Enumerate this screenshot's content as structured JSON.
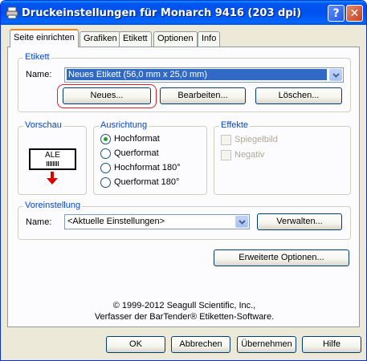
{
  "window": {
    "title": "Druckeinstellungen für Monarch 9416 (203 dpi)",
    "help_icon": "?",
    "close_icon": "✕"
  },
  "tabs": [
    {
      "label": "Seite einrichten",
      "active": true
    },
    {
      "label": "Grafiken",
      "active": false
    },
    {
      "label": "Etikett",
      "active": false
    },
    {
      "label": "Optionen",
      "active": false
    },
    {
      "label": "Info",
      "active": false
    }
  ],
  "etikett": {
    "group_label": "Etikett",
    "name_label": "Name:",
    "name_value": "Neues Etikett (56,0 mm x 25,0 mm)",
    "buttons": {
      "new": "Neues...",
      "edit": "Bearbeiten...",
      "delete": "Löschen..."
    }
  },
  "vorschau": {
    "group_label": "Vorschau",
    "preview_text": "ALE"
  },
  "ausrichtung": {
    "group_label": "Ausrichtung",
    "options": [
      {
        "label": "Hochformat",
        "checked": true
      },
      {
        "label": "Querformat",
        "checked": false
      },
      {
        "label": "Hochformat 180°",
        "checked": false
      },
      {
        "label": "Querformat 180°",
        "checked": false
      }
    ]
  },
  "effekte": {
    "group_label": "Effekte",
    "options": [
      {
        "label": "Spiegelbild",
        "checked": false,
        "enabled": false
      },
      {
        "label": "Negativ",
        "checked": false,
        "enabled": false
      }
    ]
  },
  "voreinstellung": {
    "group_label": "Voreinstellung",
    "name_label": "Name:",
    "name_value": "<Aktuelle Einstellungen>",
    "manage_button": "Verwalten..."
  },
  "advanced_button": "Erweiterte Optionen...",
  "copyright": {
    "line1": "© 1999-2012 Seagull Scientific, Inc.,",
    "line2": "Verfasser der BarTender® Etiketten-Software."
  },
  "dialog_buttons": {
    "ok": "OK",
    "cancel": "Abbrechen",
    "apply": "Übernehmen",
    "help": "Hilfe"
  },
  "colors": {
    "titlebar": "#0053ee",
    "group_label": "#0046d5",
    "selection": "#316ac5",
    "highlight_ring": "#e02020",
    "preview_arrow": "#dd0000"
  }
}
